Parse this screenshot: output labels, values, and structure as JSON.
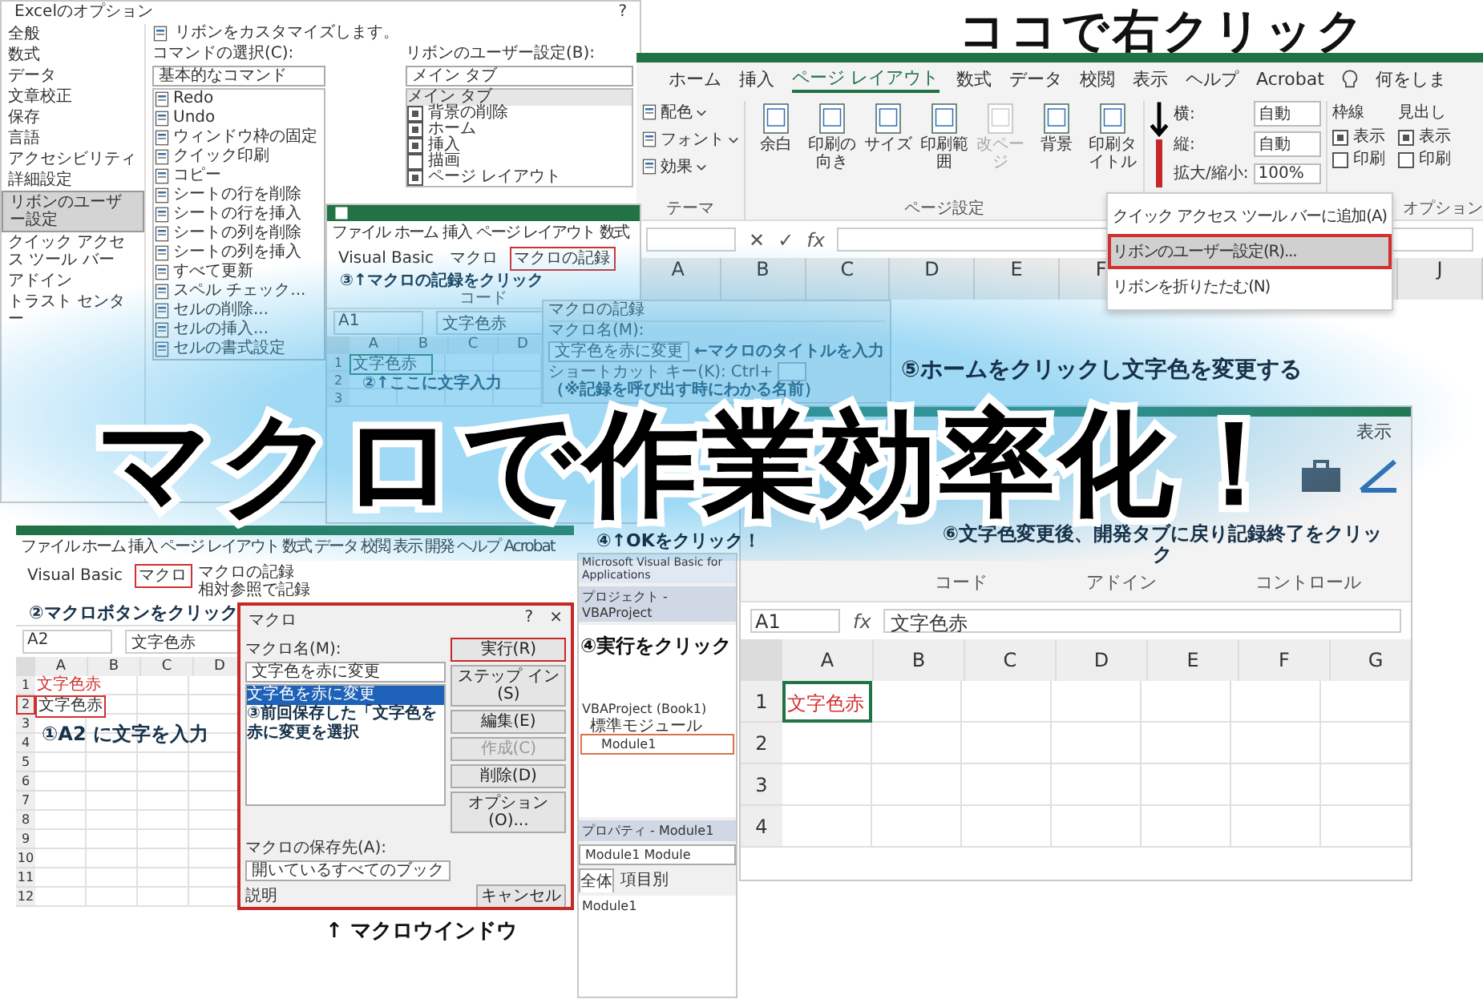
{
  "options_dialog": {
    "title": "Excelのオプション",
    "help": "?",
    "nav": [
      {
        "label": "全般",
        "selected": false
      },
      {
        "label": "数式",
        "selected": false
      },
      {
        "label": "データ",
        "selected": false
      },
      {
        "label": "文章校正",
        "selected": false
      },
      {
        "label": "保存",
        "selected": false
      },
      {
        "label": "言語",
        "selected": false
      },
      {
        "label": "アクセシビリティ",
        "selected": false
      },
      {
        "label": "詳細設定",
        "selected": false
      },
      {
        "label": "リボンのユーザー設定",
        "selected": true
      },
      {
        "label": "クイック アクセス ツール バー",
        "selected": false
      },
      {
        "label": "アドイン",
        "selected": false
      },
      {
        "label": "トラスト センター",
        "selected": false
      }
    ],
    "heading": "リボンをカスタマイズします。",
    "commands_label": "コマンドの選択(C):",
    "commands_value": "基本的なコマンド",
    "ribbon_label": "リボンのユーザー設定(B):",
    "ribbon_value": "メイン タブ",
    "commands": [
      "Redo",
      "Undo",
      "ウィンドウ枠の固定",
      "クイック印刷",
      "コピー",
      "シートの行を削除",
      "シートの行を挿入",
      "シートの列を削除",
      "シートの列を挿入",
      "すべて更新",
      "スペル チェック...",
      "セルの削除...",
      "セルの挿入...",
      "セルの書式設定"
    ],
    "tree_title": "メイン タブ",
    "tree": [
      {
        "label": "背景の削除",
        "checked": true
      },
      {
        "label": "ホーム",
        "checked": true
      },
      {
        "label": "挿入",
        "checked": true
      },
      {
        "label": "描画",
        "checked": false
      },
      {
        "label": "ページ レイアウト",
        "checked": true
      }
    ]
  },
  "top_ribbon": {
    "callout": "ココで右クリック",
    "tabs": [
      {
        "label": "ホーム",
        "selected": false
      },
      {
        "label": "挿入",
        "selected": false
      },
      {
        "label": "ページ レイアウト",
        "selected": true
      },
      {
        "label": "数式",
        "selected": false
      },
      {
        "label": "データ",
        "selected": false
      },
      {
        "label": "校閲",
        "selected": false
      },
      {
        "label": "表示",
        "selected": false
      },
      {
        "label": "ヘルプ",
        "selected": false
      },
      {
        "label": "Acrobat",
        "selected": false
      }
    ],
    "search": "何をしま",
    "theme_buttons": [
      "配色",
      "フォント",
      "効果"
    ],
    "theme_group": "テーマ",
    "page_buttons": [
      {
        "label": "余白",
        "disabled": false
      },
      {
        "label": "印刷の向き",
        "disabled": false
      },
      {
        "label": "サイズ",
        "disabled": false
      },
      {
        "label": "印刷範囲",
        "disabled": false
      },
      {
        "label": "改ページ",
        "disabled": true
      },
      {
        "label": "背景",
        "disabled": false
      },
      {
        "label": "印刷タイトル",
        "disabled": false
      }
    ],
    "page_group": "ページ設定",
    "scale": [
      {
        "label": "横:",
        "value": "自動"
      },
      {
        "label": "縦:",
        "value": "自動"
      },
      {
        "label": "拡大/縮小:",
        "value": "100%"
      }
    ],
    "sheet_options": [
      {
        "title": "枠線",
        "items": [
          {
            "label": "表示",
            "checked": true
          },
          {
            "label": "印刷",
            "checked": false
          }
        ]
      },
      {
        "title": "見出し",
        "items": [
          {
            "label": "表示",
            "checked": true
          },
          {
            "label": "印刷",
            "checked": false
          }
        ]
      }
    ],
    "options_group": "オプション",
    "formula_icons": [
      "✕",
      "✓",
      "fx"
    ],
    "columns": [
      "A",
      "B",
      "C",
      "D",
      "E",
      "F"
    ],
    "columns_right": [
      "J"
    ],
    "context_menu": [
      {
        "label": "クイック アクセス ツール バーに追加(A)",
        "selected": false
      },
      {
        "label": "リボンのユーザー設定(R)...",
        "selected": true
      },
      {
        "label": "リボンを折りたたむ(N)",
        "selected": false
      }
    ]
  },
  "record_window": {
    "tabs": [
      "ファイル",
      "ホーム",
      "挿入",
      "ページ レイアウト",
      "数式"
    ],
    "buttons": [
      {
        "label": "Visual Basic",
        "selected": false
      },
      {
        "label": "マクロ",
        "selected": false
      },
      {
        "label": "マクロの記録",
        "selected": true
      }
    ],
    "note_record": "③↑マクロの記録をクリック",
    "group": "コード",
    "cell_ref": "A1",
    "formula": "文字色赤",
    "columns": [
      "A",
      "B",
      "C",
      "D"
    ],
    "rows": [
      "1",
      "2",
      "3"
    ],
    "a1": "文字色赤",
    "note_input": "②↑ここに文字入力"
  },
  "record_dialog": {
    "title": "マクロの記録",
    "name_label": "マクロ名(M):",
    "name_value": "文字色を赤に変更",
    "note_title": "←マクロのタイトルを入力",
    "shortcut_label": "ショートカット キー(K):",
    "ctrl": "Ctrl+",
    "note_name": "（※記録を呼び出す時にわかる名前）",
    "note_ok": "④↑OKをクリック！"
  },
  "headline": "マクロで作業効率化！",
  "macro_window": {
    "tabs": [
      "ファイル",
      "ホーム",
      "挿入",
      "ページ レイアウト",
      "数式",
      "データ",
      "校閲",
      "表示",
      "開発",
      "ヘルプ",
      "Acrobat"
    ],
    "buttons": [
      {
        "label": "Visual Basic",
        "selected": false
      },
      {
        "label": "マクロ",
        "selected": true
      }
    ],
    "side_buttons": [
      "マクロの記録",
      "相対参照で記録"
    ],
    "note_macro": "②マクロボタンをクリック",
    "cell_ref": "A2",
    "formula": "文字色赤",
    "columns": [
      "A",
      "B",
      "C",
      "D"
    ],
    "rows": [
      "1",
      "2",
      "3",
      "4",
      "5",
      "6",
      "7",
      "8",
      "9",
      "10",
      "11",
      "12"
    ],
    "a1": "文字色赤",
    "a2": "文字色赤",
    "note_input": "①A2 に文字を入力"
  },
  "macro_dialog": {
    "title": "マクロ",
    "help": "?",
    "close": "×",
    "name_label": "マクロ名(M):",
    "name_value": "文字色を赤に変更",
    "list": [
      {
        "label": "文字色を赤に変更",
        "selected": true
      }
    ],
    "note_select": "③前回保存した「文字色を赤に変更を選択",
    "buttons": [
      {
        "label": "実行(R)",
        "selected": true,
        "disabled": false
      },
      {
        "label": "ステップ イン(S)",
        "selected": false,
        "disabled": false
      },
      {
        "label": "編集(E)",
        "selected": false,
        "disabled": false
      },
      {
        "label": "作成(C)",
        "selected": false,
        "disabled": true
      },
      {
        "label": "削除(D)",
        "selected": false,
        "disabled": false
      },
      {
        "label": "オプション(O)...",
        "selected": false,
        "disabled": false
      }
    ],
    "store_label": "マクロの保存先(A):",
    "store_value": "開いているすべてのブック",
    "desc_label": "説明",
    "cancel": "キャンセル",
    "caption": "↑ マクロウインドウ"
  },
  "vba": {
    "title": "Microsoft Visual Basic for Applications",
    "project_title": "プロジェクト - VBAProject",
    "tree": [
      {
        "label": "VBAProject (Book1)",
        "selected": false,
        "children": [
          {
            "label": "標準モジュール",
            "selected": false,
            "children": [
              {
                "label": "Module1",
                "selected": true
              }
            ]
          }
        ]
      }
    ],
    "note_run": "④実行をクリック",
    "props_title": "プロパティ - Module1",
    "props_value": "Module1 Module",
    "props_tabs": [
      {
        "label": "全体",
        "selected": true
      },
      {
        "label": "項目別",
        "selected": false
      }
    ],
    "props_row": "Module1"
  },
  "result_window": {
    "note_home": "⑤ホームをクリックし文字色を変更する",
    "tabs": [
      "表示"
    ],
    "note_stop": "⑥文字色変更後、開発タブに戻り記録終了をクリック",
    "groups": [
      "コード",
      "アドイン",
      "コントロール"
    ],
    "formula_icon": "fx",
    "cell_ref": "A1",
    "formula": "文字色赤",
    "columns": [
      "A",
      "B",
      "C",
      "D",
      "E",
      "F",
      "G"
    ],
    "rows": [
      "1",
      "2",
      "3",
      "4"
    ],
    "a1": "文字色赤"
  }
}
